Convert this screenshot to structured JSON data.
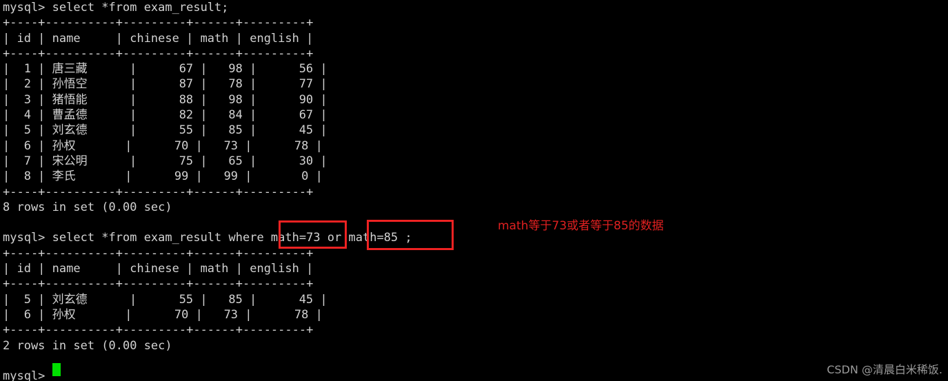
{
  "terminal": {
    "prompt": "mysql>",
    "background_color": "#000000",
    "text_color": "#d2d2d2",
    "cursor_color": "#00e000",
    "accent_color": "#ee2222"
  },
  "session": {
    "command_1": "mysql> select *from exam_result;",
    "table_1": {
      "border": "+----+----------+---------+------+---------+",
      "header": "| id | name     | chinese | math | english |",
      "rows": [
        "|  1 | 唐三藏      |      67 |   98 |      56 |",
        "|  2 | 孙悟空      |      87 |   78 |      77 |",
        "|  3 | 猪悟能      |      88 |   98 |      90 |",
        "|  4 | 曹孟德      |      82 |   84 |      67 |",
        "|  5 | 刘玄德      |      55 |   85 |      45 |",
        "|  6 | 孙权       |      70 |   73 |      78 |",
        "|  7 | 宋公明      |      75 |   65 |      30 |",
        "|  8 | 李氏       |      99 |   99 |       0 |"
      ],
      "status": "8 rows in set (0.00 sec)"
    },
    "command_2": "mysql> select *from exam_result where math=73 or math=85 ;",
    "table_2": {
      "border": "+----+----------+---------+------+---------+",
      "header": "| id | name     | chinese | math | english |",
      "rows": [
        "|  5 | 刘玄德      |      55 |   85 |      45 |",
        "|  6 | 孙权       |      70 |   73 |      78 |"
      ],
      "status": "2 rows in set (0.00 sec)"
    },
    "command_3": "mysql> "
  },
  "annotations": {
    "note_text": "math等于73或者等于85的数据",
    "highlight_1": "math=73",
    "highlight_2": "math=85 ;"
  },
  "watermark": {
    "text": "CSDN @清晨白米稀饭."
  },
  "result_data": {
    "type": "table",
    "columns": [
      "id",
      "name",
      "chinese",
      "math",
      "english"
    ],
    "full_table": [
      {
        "id": 1,
        "name": "唐三藏",
        "chinese": 67,
        "math": 98,
        "english": 56
      },
      {
        "id": 2,
        "name": "孙悟空",
        "chinese": 87,
        "math": 78,
        "english": 77
      },
      {
        "id": 3,
        "name": "猪悟能",
        "chinese": 88,
        "math": 98,
        "english": 90
      },
      {
        "id": 4,
        "name": "曹孟德",
        "chinese": 82,
        "math": 84,
        "english": 67
      },
      {
        "id": 5,
        "name": "刘玄德",
        "chinese": 55,
        "math": 85,
        "english": 45
      },
      {
        "id": 6,
        "name": "孙权",
        "chinese": 70,
        "math": 73,
        "english": 78
      },
      {
        "id": 7,
        "name": "宋公明",
        "chinese": 75,
        "math": 65,
        "english": 30
      },
      {
        "id": 8,
        "name": "李氏",
        "chinese": 99,
        "math": 99,
        "english": 0
      }
    ],
    "filtered_table": [
      {
        "id": 5,
        "name": "刘玄德",
        "chinese": 55,
        "math": 85,
        "english": 45
      },
      {
        "id": 6,
        "name": "孙权",
        "chinese": 70,
        "math": 73,
        "english": 78
      }
    ]
  }
}
